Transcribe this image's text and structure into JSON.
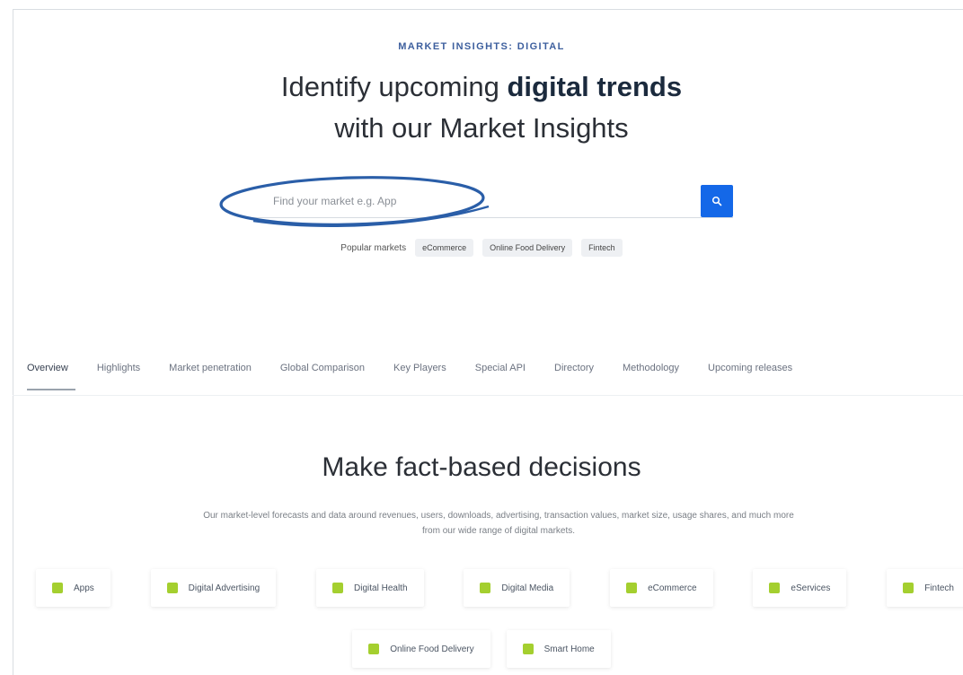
{
  "hero": {
    "eyebrow": "MARKET INSIGHTS: DIGITAL",
    "title_line1_prefix": "Identify upcoming ",
    "title_line1_bold": "digital trends",
    "title_line2": "with our Market Insights"
  },
  "search": {
    "placeholder": "Find your market e.g. App",
    "button_icon": "search-icon"
  },
  "popular": {
    "label": "Popular markets",
    "chips": [
      "eCommerce",
      "Online Food Delivery",
      "Fintech"
    ]
  },
  "tabs": [
    "Overview",
    "Highlights",
    "Market penetration",
    "Global Comparison",
    "Key Players",
    "Special API",
    "Directory",
    "Methodology",
    "Upcoming releases"
  ],
  "section": {
    "title": "Make fact-based decisions",
    "description": "Our market-level forecasts and data around revenues, users, downloads, advertising, transaction values, market size, usage shares, and much more from our wide range of digital markets."
  },
  "markets_row1": [
    "Apps",
    "Digital Advertising",
    "Digital Health",
    "Digital Media",
    "eCommerce",
    "eServices",
    "Fintech"
  ],
  "markets_row2": [
    "Online Food Delivery",
    "Smart Home"
  ],
  "colors": {
    "accent_blue": "#1468e8",
    "annotation_blue": "#2a5ea8",
    "market_icon_green": "#a4cf2f"
  }
}
